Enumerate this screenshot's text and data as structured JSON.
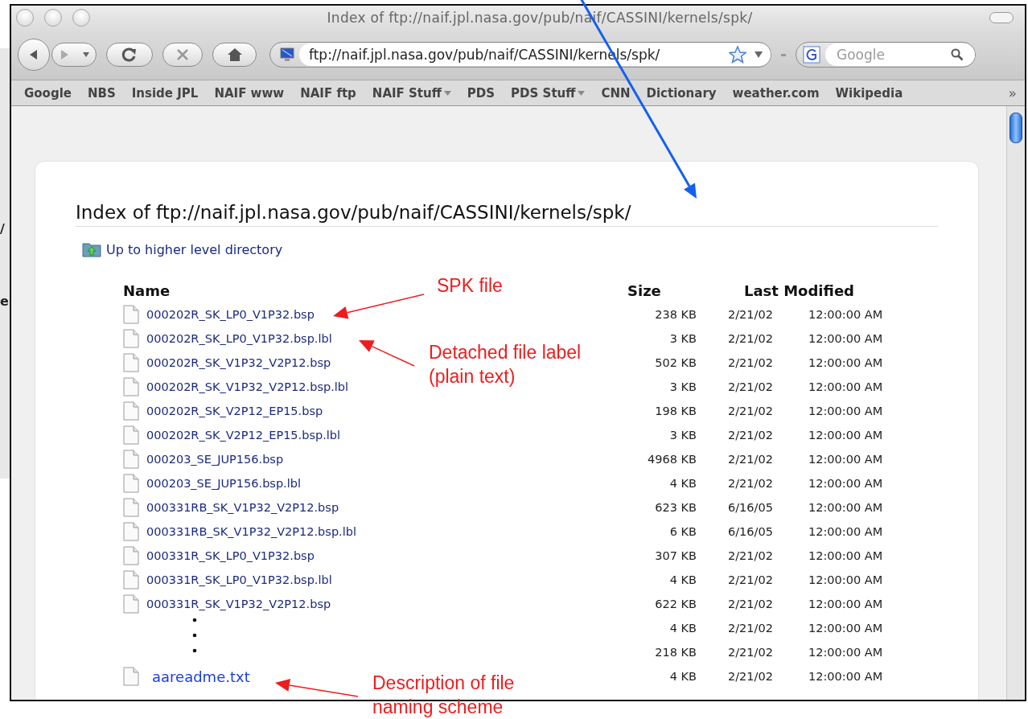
{
  "background_window": {
    "texts": [
      "/",
      "e"
    ]
  },
  "window": {
    "title": "Index of ftp://naif.jpl.nasa.gov/pub/naif/CASSINI/kernels/spk/"
  },
  "toolbar": {
    "address": "ftp://naif.jpl.nasa.gov/pub/naif/CASSINI/kernels/spk/",
    "search": {
      "placeholder": "Google"
    }
  },
  "bookmarks": [
    {
      "label": "Google",
      "menu": false
    },
    {
      "label": "NBS",
      "menu": false
    },
    {
      "label": "Inside JPL",
      "menu": false
    },
    {
      "label": "NAIF www",
      "menu": false
    },
    {
      "label": "NAIF ftp",
      "menu": false
    },
    {
      "label": "NAIF Stuff",
      "menu": true
    },
    {
      "label": "PDS",
      "menu": false
    },
    {
      "label": "PDS Stuff",
      "menu": true
    },
    {
      "label": "CNN",
      "menu": false
    },
    {
      "label": "Dictionary",
      "menu": false
    },
    {
      "label": "weather.com",
      "menu": false
    },
    {
      "label": "Wikipedia",
      "menu": false
    }
  ],
  "bookmarks_overflow": "»",
  "page": {
    "heading": "Index of ftp://naif.jpl.nasa.gov/pub/naif/CASSINI/kernels/spk/",
    "parent_link": "Up to higher level directory",
    "columns": [
      "Name",
      "Size",
      "Last Modified"
    ],
    "rows": [
      {
        "kind": "file",
        "name": "000202R_SK_LP0_V1P32.bsp",
        "size": "238 KB",
        "date": "2/21/02",
        "time": "12:00:00 AM"
      },
      {
        "kind": "file",
        "name": "000202R_SK_LP0_V1P32.bsp.lbl",
        "size": "3 KB",
        "date": "2/21/02",
        "time": "12:00:00 AM"
      },
      {
        "kind": "file",
        "name": "000202R_SK_V1P32_V2P12.bsp",
        "size": "502 KB",
        "date": "2/21/02",
        "time": "12:00:00 AM"
      },
      {
        "kind": "file",
        "name": "000202R_SK_V1P32_V2P12.bsp.lbl",
        "size": "3 KB",
        "date": "2/21/02",
        "time": "12:00:00 AM"
      },
      {
        "kind": "file",
        "name": "000202R_SK_V2P12_EP15.bsp",
        "size": "198 KB",
        "date": "2/21/02",
        "time": "12:00:00 AM"
      },
      {
        "kind": "file",
        "name": "000202R_SK_V2P12_EP15.bsp.lbl",
        "size": "3 KB",
        "date": "2/21/02",
        "time": "12:00:00 AM"
      },
      {
        "kind": "file",
        "name": "000203_SE_JUP156.bsp",
        "size": "4968 KB",
        "date": "2/21/02",
        "time": "12:00:00 AM"
      },
      {
        "kind": "file",
        "name": "000203_SE_JUP156.bsp.lbl",
        "size": "4 KB",
        "date": "2/21/02",
        "time": "12:00:00 AM"
      },
      {
        "kind": "file",
        "name": "000331RB_SK_V1P32_V2P12.bsp",
        "size": "623 KB",
        "date": "6/16/05",
        "time": "12:00:00 AM"
      },
      {
        "kind": "file",
        "name": "000331RB_SK_V1P32_V2P12.bsp.lbl",
        "size": "6 KB",
        "date": "6/16/05",
        "time": "12:00:00 AM"
      },
      {
        "kind": "file",
        "name": "000331R_SK_LP0_V1P32.bsp",
        "size": "307 KB",
        "date": "2/21/02",
        "time": "12:00:00 AM"
      },
      {
        "kind": "file",
        "name": "000331R_SK_LP0_V1P32.bsp.lbl",
        "size": "4 KB",
        "date": "2/21/02",
        "time": "12:00:00 AM"
      },
      {
        "kind": "file",
        "name": "000331R_SK_V1P32_V2P12.bsp",
        "size": "622 KB",
        "date": "2/21/02",
        "time": "12:00:00 AM"
      },
      {
        "kind": "elided_start",
        "size": "4 KB",
        "date": "2/21/02",
        "time": "12:00:00 AM"
      },
      {
        "kind": "elided_end",
        "size": "218 KB",
        "date": "2/21/02",
        "time": "12:00:00 AM"
      },
      {
        "kind": "highlighted",
        "name": "aareadme.txt",
        "size": "4 KB",
        "date": "2/21/02",
        "time": "12:00:00 AM"
      }
    ]
  },
  "annotations": [
    {
      "lines": [
        "SPK file"
      ]
    },
    {
      "lines": [
        "Detached file label",
        "(plain text)"
      ]
    },
    {
      "lines": [
        "Description of file",
        "naming scheme"
      ]
    }
  ]
}
